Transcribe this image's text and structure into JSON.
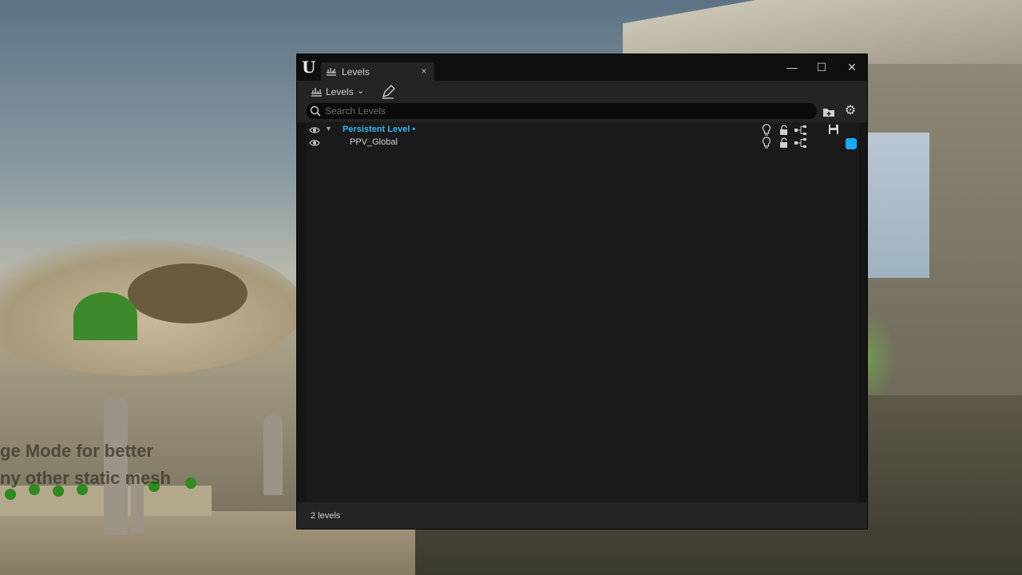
{
  "window": {
    "tab_label": "Levels",
    "tab_close": "×",
    "minimize": "—",
    "maximize": "☐",
    "close": "✕"
  },
  "toolbar": {
    "levels_menu_label": "Levels",
    "levels_menu_chevron": "⌄"
  },
  "search": {
    "placeholder": "Search Levels",
    "value": ""
  },
  "levels": [
    {
      "name": "Persistent Level •",
      "visible": true,
      "expanded": true,
      "is_persistent": true,
      "locked": false
    },
    {
      "name": "PPV_Global",
      "visible": true,
      "is_persistent": false,
      "locked": false,
      "color": "#19a9f5"
    }
  ],
  "footer": {
    "status": "2 levels"
  },
  "colors": {
    "accent": "#36b5ee",
    "level_color": "#19a9f5"
  },
  "icons": [
    "unreal-logo-icon",
    "levels-icon",
    "pencil-icon",
    "search-icon",
    "add-folder-icon",
    "gear-icon",
    "eye-icon",
    "lightbulb-icon",
    "unlock-icon",
    "hierarchy-icon",
    "save-icon"
  ],
  "background_text": {
    "line1": "ge Mode for better",
    "line2": "ny other static mesh"
  }
}
